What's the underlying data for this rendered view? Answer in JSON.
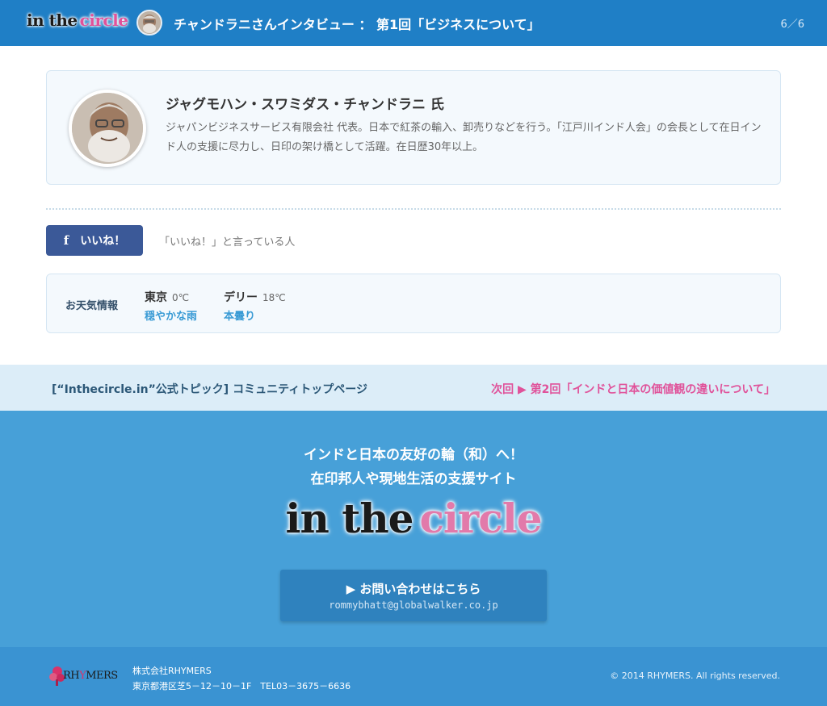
{
  "header": {
    "logo_word1": "in the",
    "logo_word2": "circle",
    "title": "チャンドラニさんインタビュー ： 第1回「ビジネスについて」",
    "page_indicator": "6／6"
  },
  "profile": {
    "name": "ジャグモハン・スワミダス・チャンドラニ 氏",
    "description": "ジャパンビジネスサービス有限会社 代表。日本で紅茶の輸入、卸売りなどを行う。「江戸川インド人会」の会長として在日インド人の支援に尽力し、日印の架け橋として活躍。在日歴30年以上。"
  },
  "like": {
    "icon_letter": "f",
    "button_label": "いいね！",
    "note": "「いいね！」と言っている人"
  },
  "weather": {
    "label": "お天気情報",
    "cities": [
      {
        "name": "東京",
        "temp": "0℃",
        "condition": "穏やかな雨"
      },
      {
        "name": "デリー",
        "temp": "18℃",
        "condition": "本曇り"
      }
    ]
  },
  "nav": {
    "community_link": "[“Inthecircle.in”公式トピック] コミュニティトップページ",
    "next_link": "次回 ▶ 第2回「インドと日本の価値観の違いについて」"
  },
  "footer": {
    "tagline1": "インドと日本の友好の輪（和）へ！",
    "tagline2": "在印邦人や現地生活の支援サイト",
    "logo_word1": "in the",
    "logo_word2": "circle",
    "contact_label": "▶ お問い合わせはこちら",
    "contact_email": "rommybhatt@globalwalker.co.jp"
  },
  "bottom": {
    "company_logo_text_a": "RH",
    "company_logo_text_b": "Y",
    "company_logo_text_c": "MERS",
    "company_name": "株式会社RHYMERS",
    "address": "東京都港区芝5－12－10－1F　TEL03－3675－6636",
    "copyright": "© 2014 RHYMERS. All rights reserved."
  },
  "colors": {
    "header_blue": "#1f7fc6",
    "footer_blue": "#47a0d8",
    "accent_pink": "#e0529a",
    "facebook_blue": "#3b5998"
  }
}
